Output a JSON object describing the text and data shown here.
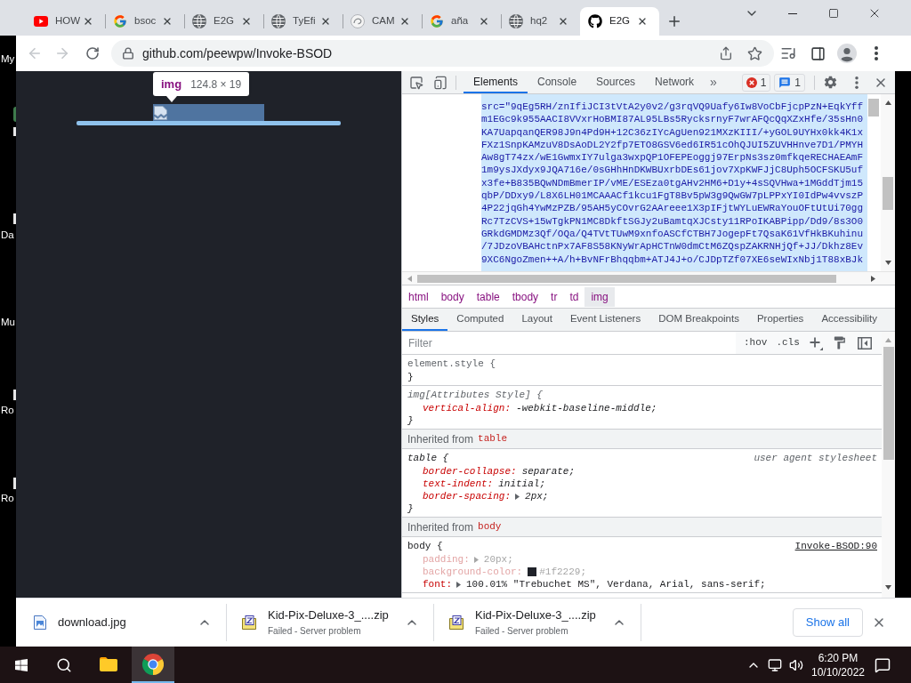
{
  "desktop": {
    "icons": [
      {
        "label": "My"
      },
      {
        "label": "Da"
      },
      {
        "label": "Mu"
      },
      {
        "label": "Ro"
      },
      {
        "label": "Ro"
      }
    ]
  },
  "browser": {
    "tabs": [
      {
        "kind": "youtube",
        "title": "HOW",
        "selected": false
      },
      {
        "kind": "google",
        "title": "bsoc",
        "selected": false
      },
      {
        "kind": "globe",
        "title": "E2G",
        "selected": false
      },
      {
        "kind": "globe",
        "title": "TyEfi",
        "selected": false
      },
      {
        "kind": "shell",
        "title": "CAM",
        "selected": false
      },
      {
        "kind": "google",
        "title": "aña",
        "selected": false
      },
      {
        "kind": "globe",
        "title": "hq2",
        "selected": false
      },
      {
        "kind": "github",
        "title": "E2G",
        "selected": true
      }
    ],
    "nav_buttons": [
      {
        "kind": "back",
        "disabled": true
      },
      {
        "kind": "forward",
        "disabled": true
      },
      {
        "kind": "reload",
        "disabled": false
      }
    ],
    "address_bar": {
      "url": "github.com/peewpw/Invoke-BSOD"
    }
  },
  "page": {
    "inspect_tooltip": {
      "tag": "img",
      "size": "124.8 × 19"
    }
  },
  "devtools": {
    "tabs": [
      {
        "label": "Elements",
        "selected": true
      },
      {
        "label": "Console",
        "selected": false
      },
      {
        "label": "Sources",
        "selected": false
      },
      {
        "label": "Network",
        "selected": false
      }
    ],
    "more_tabs": "»",
    "counters": [
      {
        "kind": "error",
        "count": "1"
      },
      {
        "kind": "message",
        "count": "1"
      }
    ],
    "elements": {
      "selected": true,
      "lines": [
        "src=\"9qEg5RH/znIfiJCI3tVtA2y0v2/g3rqVQ9Uafy6Iw8VoCbFjcpPzN+EqkYff",
        "m1EGc9k955AACI8VVxrHoBMI87AL95LBs5RycksrnyF7wrAFQcQqXZxHfe/35sHn0",
        "KA7UapqanQER98J9n4Pd9H+12C36zIYcAgUen921MXzKIII/+yGOL9UYHx0kk4K1x",
        "FXz1SnpKAMzuV8DsAoDL2Y2fp7ETO8GSV6ed6IR51cOhQJUI5ZUVHHnve7D1/PMYH",
        "Aw8gT74zx/wE1GwmxIY7ulga3wxpQP1OFEPEoggj97ErpNs3sz0mfkqeRECHAEAmF",
        "1m9ysJXdyx9JQA716e/0sGHhHnDKWBUxrbDEs61jov7XpKWFJjC8Uph5OCFSKU5uf",
        "x3fe+B835BQwNDmBmerIP/vME/ESEza0tgAHv2HM6+D1y+4sSQVHwa+1MGddTjm15",
        "qbP/DDxy9/L8X6LH01MCAAACf1kcu1FgT8Bv5pW3g9QwGW7pLPPxYI0IdPw4vvszP",
        "4P22jqGh4YwMzPZB/95AH5yCOvrG2AAreee1X3pIFjtWYLuEWRaYouOFtUtUi70gg",
        "Rc7TzCVS+15wTgkPN1MC8DkftSGJy2uBamtqXJCsty11RPoIKABPipp/Dd9/8s3O0",
        "GRkdGMDMz3Qf/OQa/Q4TVtTUwM9xnfoASCfCTBH7JogepFt7QsaK61VfHkBKuhinu",
        "/7JDzoVBAHctnPx7AF8S58KNyWrApHCTnW0dmCtM6ZQspZAKRNHjQf+JJ/Dkhz8Ev",
        "9XC6NgoZmen++A/h+BvNFrBhqqbm+ATJ4J+o/CJDpTZf07XE6seWIxNbj1T88xBJk"
      ]
    },
    "breadcrumbs": [
      {
        "label": "html",
        "selected": false
      },
      {
        "label": "body",
        "selected": false
      },
      {
        "label": "table",
        "selected": false
      },
      {
        "label": "tbody",
        "selected": false
      },
      {
        "label": "tr",
        "selected": false
      },
      {
        "label": "td",
        "selected": false
      },
      {
        "label": "img",
        "selected": true
      }
    ],
    "sidebar_tabs": [
      {
        "label": "Styles",
        "selected": true
      },
      {
        "label": "Computed",
        "selected": false
      },
      {
        "label": "Layout",
        "selected": false
      },
      {
        "label": "Event Listeners",
        "selected": false
      },
      {
        "label": "DOM Breakpoints",
        "selected": false
      },
      {
        "label": "Properties",
        "selected": false
      },
      {
        "label": "Accessibility",
        "selected": false
      }
    ],
    "filter": {
      "placeholder": "Filter"
    },
    "toggles": [
      ":hov",
      ".cls"
    ],
    "styles": [
      {
        "kind": "inline",
        "selector": "element.style {",
        "close": "}"
      },
      {
        "kind": "attributes",
        "selector": "img[Attributes Style] {",
        "declarations": [
          {
            "property": "vertical-align:",
            "value": "-webkit-baseline-middle;",
            "inactive": false,
            "expandable": false
          }
        ],
        "close": "}"
      },
      {
        "kind": "inherited",
        "label": "Inherited from",
        "tag": "table"
      },
      {
        "kind": "user-agent",
        "selector": "table {",
        "source": "user agent stylesheet",
        "declarations": [
          {
            "property": "border-collapse:",
            "value": "separate;",
            "inactive": false,
            "expandable": false
          },
          {
            "property": "text-indent:",
            "value": "initial;",
            "inactive": false,
            "expandable": false
          },
          {
            "property": "border-spacing:",
            "value": "2px;",
            "inactive": false,
            "expandable": true
          }
        ],
        "close": "}"
      },
      {
        "kind": "inherited",
        "label": "Inherited from",
        "tag": "body"
      },
      {
        "kind": "author",
        "selector": "body {",
        "source": "Invoke-BSOD:90",
        "declarations": [
          {
            "property": "padding:",
            "value": "20px;",
            "inactive": true,
            "expandable": true
          },
          {
            "property": "background-color:",
            "value": "#1f2229;",
            "inactive": true,
            "expandable": false,
            "color": "#1f2229"
          },
          {
            "property": "font:",
            "value": "100.01% \"Trebuchet MS\", Verdana, Arial, sans-serif;",
            "inactive": false,
            "expandable": true
          }
        ]
      }
    ]
  },
  "downloads": {
    "items": [
      {
        "kind": "image",
        "name": "download.jpg"
      },
      {
        "kind": "archive",
        "name": "Kid-Pix-Deluxe-3_....zip",
        "status": "Failed - Server problem"
      },
      {
        "kind": "archive",
        "name": "Kid-Pix-Deluxe-3_....zip",
        "status": "Failed - Server problem"
      }
    ],
    "show_all": "Show all"
  },
  "taskbar": {
    "apps": [
      {
        "kind": "explorer",
        "selected": false
      },
      {
        "kind": "chrome",
        "selected": true
      }
    ],
    "time": "6:20 PM",
    "date": "10/10/2022"
  }
}
